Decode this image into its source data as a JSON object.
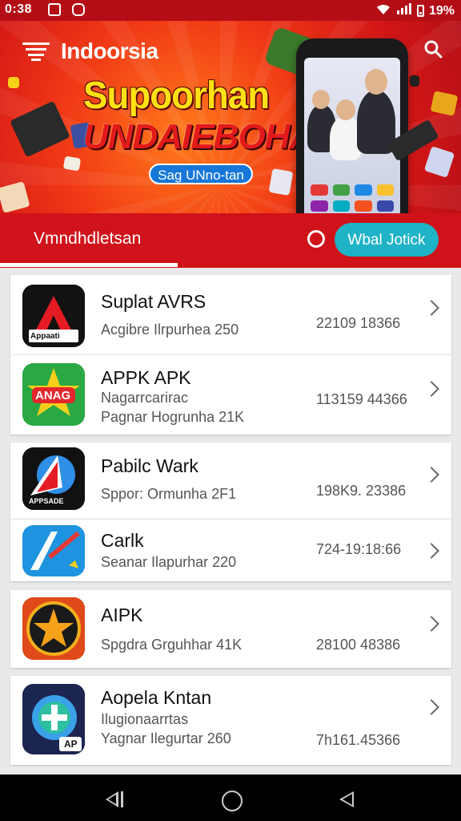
{
  "status": {
    "time": "0:38",
    "battery": "19%"
  },
  "header": {
    "brand": "Indoorsia",
    "headline1": "Supoorhan",
    "headline2": "UNDAIEBOHA",
    "pill": "Sag UNno-tan"
  },
  "tabs": {
    "active_label": "Vmndhdletsan",
    "action_label": "Wbal Jotick"
  },
  "apps": [
    {
      "title": "Suplat AVRS",
      "line1": "Acgibre Ilrpurhea 250",
      "line2": "",
      "number": "22109 18366"
    },
    {
      "title": "APPK APK",
      "line1": "Nagarrcarirac",
      "line2": "Pagnar Hogrunha 21K",
      "number": "113159 44366"
    },
    {
      "title": "Pabilc Wark",
      "line1": "Sppor: Ormunha 2F1",
      "line2": "",
      "number": "198K9. 23386"
    },
    {
      "title": "Carlk",
      "line1": "Seanar Ilapurhar 220",
      "line2": "",
      "number": "724-19:18:66"
    },
    {
      "title": "AIPK",
      "line1": "Spgdra Grguhhar 41K",
      "line2": "",
      "number": "28100 48386"
    },
    {
      "title": "Aopela Kntan",
      "line1": "Ilugionaarrtas",
      "line2": "Yagnar Ilegurtar 260",
      "number": "7h161.45366"
    }
  ],
  "icon_labels": {
    "app1": "Appaati",
    "app2": "ANAG",
    "app3": "APPSADE",
    "app6": "AP"
  },
  "colors": {
    "primary": "#d0121a",
    "accent": "#1eb3c6",
    "headline": "#ffe014"
  }
}
